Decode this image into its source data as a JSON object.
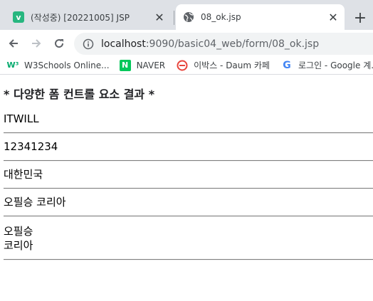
{
  "tabs": [
    {
      "title": "(작성중) [20221005] JSP",
      "favicon": "v-icon"
    },
    {
      "title": "08_ok.jsp",
      "favicon": "globe-icon"
    }
  ],
  "toolbar": {
    "url_host": "localhost",
    "url_rest": ":9090/basic04_web/form/08_ok.jsp"
  },
  "bookmarks": [
    {
      "label": "W3Schools Online...",
      "icon": "w3schools-icon"
    },
    {
      "label": "NAVER",
      "icon": "naver-icon"
    },
    {
      "label": "이박스 - Daum 카페",
      "icon": "daum-cafe-icon"
    },
    {
      "label": "로그인 - Google 계...",
      "icon": "google-icon"
    }
  ],
  "page": {
    "heading": "* 다양한 폼 컨트롤 요소 결과 *",
    "results": [
      "ITWILL",
      "12341234",
      "대한민국",
      "오필승 코리아"
    ],
    "textarea_lines": [
      "오필승",
      "코리아"
    ]
  }
}
